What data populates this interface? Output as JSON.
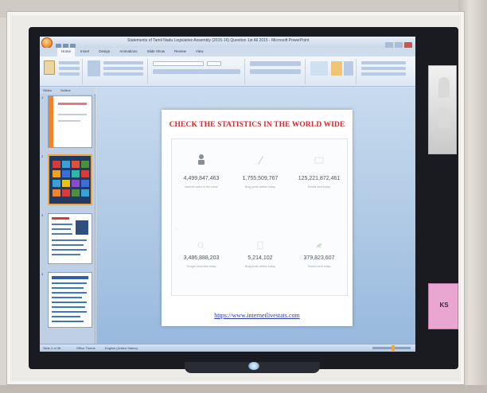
{
  "window": {
    "title": "Statements of Tamil Nadu Legislative Assembly (2015-16) Question 1st All 2015 - Microsoft PowerPoint",
    "ribbon_tabs": [
      "Home",
      "Insert",
      "Design",
      "Animations",
      "Slide Show",
      "Review",
      "View"
    ]
  },
  "slides_pane": {
    "tabs": [
      "Slides",
      "Outline"
    ],
    "thumbnails": [
      {
        "number": "1"
      },
      {
        "number": "2"
      },
      {
        "number": "3"
      },
      {
        "number": "4"
      }
    ]
  },
  "slide": {
    "title": "CHECK THE STATISTICS IN THE WORLD WIDE",
    "stats": [
      {
        "value": "4,499,847,463",
        "label": "Internet users in the world",
        "icon": "person-icon"
      },
      {
        "value": "1,755,509,767",
        "label": "Blog posts written today",
        "icon": "pen-icon"
      },
      {
        "value": "125,221,872,461",
        "label": "Emails sent today",
        "icon": "mail-icon"
      },
      {
        "value": "3,486,888,203",
        "label": "Google searches today",
        "icon": "search-icon"
      },
      {
        "value": "5,214,102",
        "label": "Blog posts written today",
        "icon": "doc-icon"
      },
      {
        "value": "379,823,607",
        "label": "Tweets sent today",
        "icon": "bird-icon"
      }
    ],
    "url": "https://www.internetlivestats.com"
  },
  "statusbar": {
    "slide_info": "Slide 2 of 35",
    "theme": "Office Theme",
    "language": "English (United States)"
  },
  "wall": {
    "tag_text": "KS"
  },
  "colors": {
    "title_red": "#d8262e",
    "url_blue": "#2a3ea8",
    "accent_orange": "#f3a53a",
    "tag_pink": "#e8a6d0"
  }
}
